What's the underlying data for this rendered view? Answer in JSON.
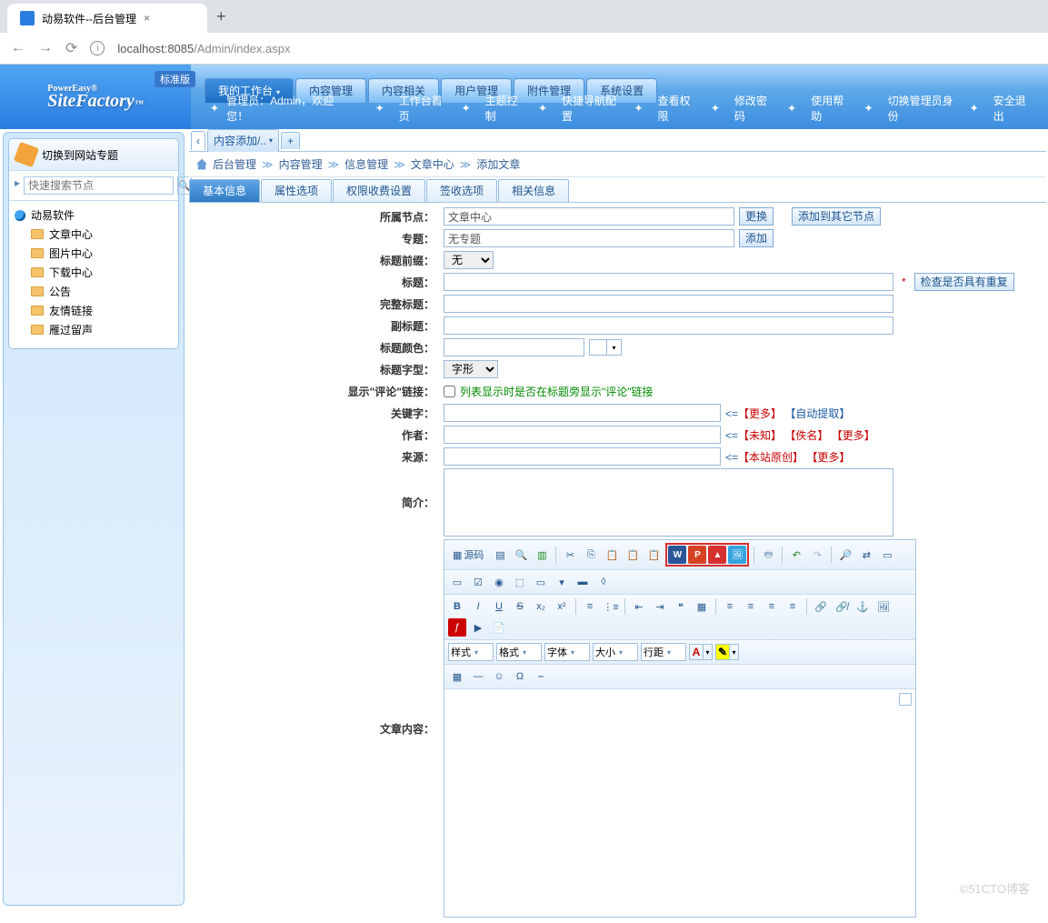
{
  "browser": {
    "tab_title": "动易软件--后台管理",
    "url_host": "localhost:8085",
    "url_path": "/Admin/index.aspx"
  },
  "header": {
    "logo_line1": "PowerEasy®",
    "logo_line2": "SiteFactory",
    "tm": "™",
    "edition": "标准版",
    "menu": [
      "我的工作台",
      "内容管理",
      "内容相关",
      "用户管理",
      "附件管理",
      "系统设置"
    ],
    "welcome_prefix": "管理员：",
    "welcome_user": "Admin",
    "welcome_suffix": "，欢迎您！",
    "sub_links": [
      "工作台首页",
      "主题控制",
      "快捷导航配置",
      "查看权限",
      "修改密码",
      "使用帮助",
      "切换管理员身份",
      "安全退出"
    ]
  },
  "sidebar": {
    "toggle_label": "切换到网站专题",
    "search_placeholder": "快速搜索节点",
    "root": "动易软件",
    "nodes": [
      "文章中心",
      "图片中心",
      "下载中心",
      "公告",
      "友情链接",
      "雁过留声"
    ]
  },
  "content_tabs": {
    "active": "内容添加/.."
  },
  "breadcrumb": [
    "后台管理",
    "内容管理",
    "信息管理",
    "文章中心",
    "添加文章"
  ],
  "form_tabs": [
    "基本信息",
    "属性选项",
    "权限收费设置",
    "签收选项",
    "相关信息"
  ],
  "form": {
    "node_label": "所属节点：",
    "node_value": "文章中心",
    "node_change": "更换",
    "node_add": "添加到其它节点",
    "topic_label": "专题：",
    "topic_value": "无专题",
    "topic_add": "添加",
    "prefix_label": "标题前缀：",
    "prefix_value": "无",
    "title_label": "标题：",
    "title_check": "检查是否具有重复",
    "fulltitle_label": "完整标题：",
    "subtitle_label": "副标题：",
    "color_label": "标题颜色：",
    "font_label": "标题字型：",
    "font_value": "字形",
    "comment_label": "显示\"评论\"链接：",
    "comment_hint": "列表显示时是否在标题旁显示\"评论\"链接",
    "keywords_label": "关键字：",
    "kw_more": "【更多】",
    "kw_auto": "【自动提取】",
    "author_label": "作者：",
    "au_unknown": "【未知】",
    "au_anon": "【佚名】",
    "au_more": "【更多】",
    "source_label": "来源：",
    "src_local": "【本站原创】",
    "src_more": "【更多】",
    "intro_label": "简介：",
    "content_label": "文章内容："
  },
  "editor": {
    "source": "源码",
    "style": "样式",
    "format": "格式",
    "font": "字体",
    "size": "大小",
    "lineheight": "行距"
  },
  "watermark": "©51CTO博客"
}
